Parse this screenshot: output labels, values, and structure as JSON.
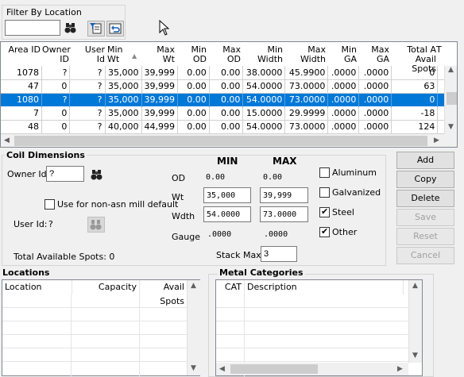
{
  "filter": {
    "title": "Filter By Location",
    "value": ""
  },
  "grid": {
    "headers": [
      [
        "",
        "Area ID"
      ],
      [
        "Owner",
        "ID"
      ],
      [
        "User",
        "Id"
      ],
      [
        "Min",
        "Wt"
      ],
      [
        "Max",
        "Wt"
      ],
      [
        "",
        "Min OD"
      ],
      [
        "",
        "Max OD"
      ],
      [
        "",
        "Min Width"
      ],
      [
        "",
        "Max Width"
      ],
      [
        "",
        "Min GA"
      ],
      [
        "",
        "Max GA"
      ],
      [
        "Total A",
        "Avail Spots"
      ],
      [
        "",
        "T"
      ]
    ],
    "rows": [
      [
        "1078",
        "?",
        "?",
        "35,000",
        "39,999",
        "0.00",
        "0.00",
        "38.0000",
        "45.9900",
        ".0000",
        ".0000",
        "0"
      ],
      [
        "47",
        "0",
        "?",
        "35,000",
        "39,999",
        "0.00",
        "0.00",
        "54.0000",
        "73.0000",
        ".0000",
        ".0000",
        "63"
      ],
      [
        "1080",
        "?",
        "?",
        "35,000",
        "39,999",
        "0.00",
        "0.00",
        "54.0000",
        "73.0000",
        ".0000",
        ".0000",
        "0"
      ],
      [
        "7",
        "0",
        "?",
        "35,000",
        "39,999",
        "0.00",
        "0.00",
        "15.0000",
        "29.9999",
        ".0000",
        ".0000",
        "-18"
      ],
      [
        "48",
        "0",
        "?",
        "40,000",
        "44,999",
        "0.00",
        "0.00",
        "54.0000",
        "73.0000",
        ".0000",
        ".0000",
        "124"
      ]
    ]
  },
  "coil": {
    "title": "Coil Dimensions",
    "owner_label": "Owner Id:",
    "owner_value": "?",
    "nonasn_label": "Use for non-asn mill default",
    "user_label": "User Id:",
    "user_value": "?",
    "total_spots": "Total Available Spots: 0",
    "min_h": "MIN",
    "max_h": "MAX",
    "od_label": "OD",
    "od_min": "0.00",
    "od_max": "0.00",
    "wt_label": "Wt",
    "wt_min": "35,000",
    "wt_max": "39,999",
    "wdth_label": "Wdth",
    "wdth_min": "54.0000",
    "wdth_max": "73.0000",
    "gauge_label": "Gauge",
    "gauge_min": ".0000",
    "gauge_max": ".0000",
    "stack_label": "Stack Max:",
    "stack_value": "3",
    "metals": [
      {
        "label": "Aluminum",
        "checked": false
      },
      {
        "label": "Galvanized",
        "checked": false
      },
      {
        "label": "Steel",
        "checked": true
      },
      {
        "label": "Other",
        "checked": true
      }
    ]
  },
  "buttons": {
    "add": "Add",
    "copy": "Copy",
    "delete": "Delete",
    "save": "Save",
    "reset": "Reset",
    "cancel": "Cancel"
  },
  "locations": {
    "title": "Locations",
    "cols": [
      "Location",
      "Capacity",
      "Avail Spots"
    ]
  },
  "metal_cats": {
    "title": "Metal Categories",
    "cols": [
      "CAT",
      "Description"
    ]
  }
}
